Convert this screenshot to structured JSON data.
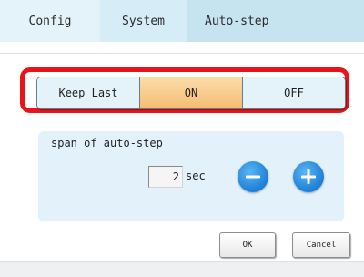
{
  "tabs": [
    {
      "label": "Config"
    },
    {
      "label": "System"
    },
    {
      "label": "Auto-step"
    }
  ],
  "mode_selector": {
    "options": [
      "Keep Last",
      "ON",
      "OFF"
    ],
    "selected": "ON"
  },
  "span": {
    "label": "span of auto-step",
    "value": "2",
    "unit": "sec"
  },
  "icons": {
    "decrease": "minus-icon",
    "increase": "plus-icon"
  },
  "buttons": {
    "ok": "OK",
    "cancel": "Cancel"
  },
  "colors": {
    "highlight": "#e8141a",
    "selected_segment": "#f5bd72",
    "stepper": "#1d7fd6"
  }
}
